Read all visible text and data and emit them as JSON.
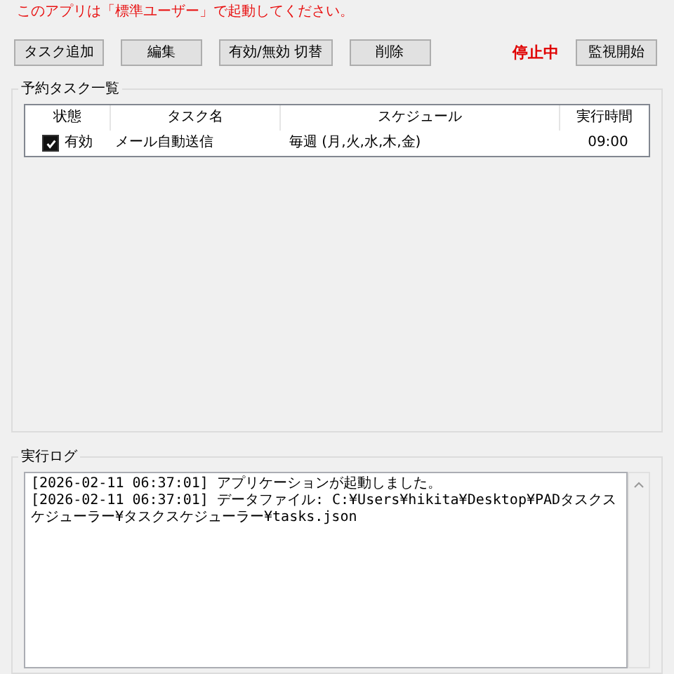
{
  "warning": "このアプリは「標準ユーザー」で起動してください。",
  "toolbar": {
    "buttons": [
      "タスク追加",
      "編集",
      "有効/無効 切替",
      "削除"
    ],
    "status": "停止中",
    "monitor_button": "監視開始"
  },
  "task_list": {
    "title": "予約タスク一覧",
    "columns": [
      "状態",
      "タスク名",
      "スケジュール",
      "実行時間"
    ],
    "rows": [
      {
        "checked": true,
        "state": "有効",
        "name": "メール自動送信",
        "schedule": "毎週 (月,火,水,木,金)",
        "time": "09:00"
      }
    ]
  },
  "log": {
    "title": "実行ログ",
    "lines": [
      "[2026-02-11 06:37:01] アプリケーションが起動しました。",
      "[2026-02-11 06:37:01] データファイル: C:¥Users¥hikita¥Desktop¥PADタスクスケジューラー¥タスクスケジューラー¥tasks.json"
    ]
  }
}
